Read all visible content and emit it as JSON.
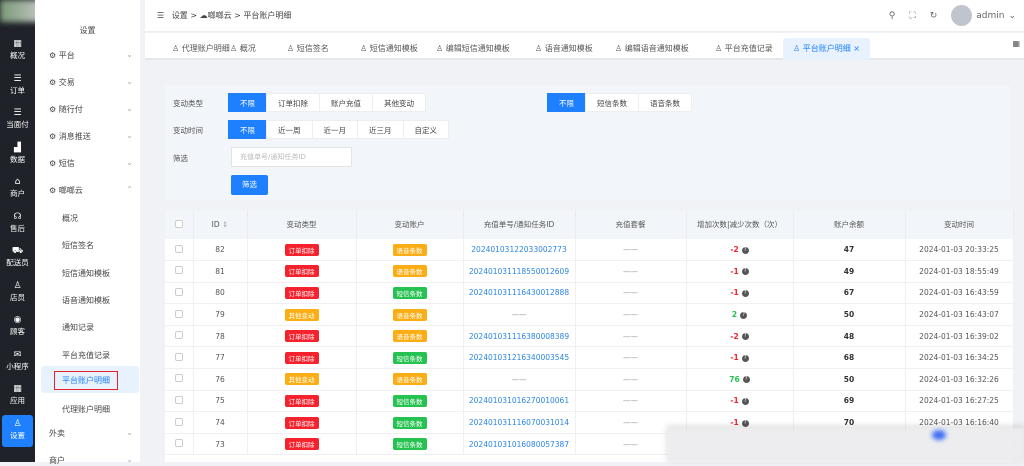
{
  "rail": [
    {
      "icon": "grid",
      "label": "概况"
    },
    {
      "icon": "list",
      "label": "订单"
    },
    {
      "icon": "list",
      "label": "当面付"
    },
    {
      "icon": "bar-chart",
      "label": "数据"
    },
    {
      "icon": "store",
      "label": "商户"
    },
    {
      "icon": "headset",
      "label": "售后"
    },
    {
      "icon": "scooter",
      "label": "配送员"
    },
    {
      "icon": "user",
      "label": "店员"
    },
    {
      "icon": "eye",
      "label": "顾客"
    },
    {
      "icon": "chat",
      "label": "小程序"
    },
    {
      "icon": "apps",
      "label": "应用"
    },
    {
      "icon": "user",
      "label": "设置"
    }
  ],
  "side": {
    "title": "设置",
    "menus": [
      {
        "label": "平台"
      },
      {
        "label": "交易"
      },
      {
        "label": "随行付"
      },
      {
        "label": "消息推送"
      },
      {
        "label": "短信"
      },
      {
        "label": "啷啷云"
      }
    ],
    "subs": [
      "概况",
      "短信签名",
      "短信通知模板",
      "语音通知模板",
      "通知记录",
      "平台充值记录",
      "平台账户明细",
      "代理账户明细"
    ],
    "after": [
      {
        "label": "外卖"
      },
      {
        "label": "商户"
      }
    ]
  },
  "breadcrumb": [
    "设置",
    "啷啷云",
    "平台账户明细"
  ],
  "user": "admin",
  "tabs": [
    "代理账户明细",
    "概况",
    "短信签名",
    "短信通知模板",
    "编辑短信通知模板",
    "语音通知模板",
    "编辑语音通知模板",
    "平台充值记录",
    "平台账户明细"
  ],
  "filters": {
    "type_label": "变动类型",
    "type_opts": [
      "不限",
      "订单扣除",
      "账户充值",
      "其他变动"
    ],
    "acct_opts": [
      "不限",
      "短信条数",
      "语音条数"
    ],
    "time_label": "变动时间",
    "time_opts": [
      "不限",
      "近一周",
      "近一月",
      "近三月",
      "自定义"
    ],
    "search_label": "筛选",
    "search_placeholder": "充值单号/通知任务ID",
    "search_btn": "筛选"
  },
  "table": {
    "headers": [
      "ID",
      "变动类型",
      "变动账户",
      "充值单号/通知任务ID",
      "充值套餐",
      "增加次数|减少次数（次）",
      "账户余额",
      "变动时间"
    ],
    "rows": [
      {
        "id": "82",
        "type": "订单扣除",
        "acct": "语音条数",
        "no": "20240103122033002773",
        "pkg": "——",
        "delta": "-2",
        "bal": "47",
        "time": "2024-01-03 20:33:25"
      },
      {
        "id": "81",
        "type": "订单扣除",
        "acct": "语音条数",
        "no": "20240103111855001260​9",
        "pkg": "——",
        "delta": "-1",
        "bal": "49",
        "time": "2024-01-03 18:55:49"
      },
      {
        "id": "80",
        "type": "订单扣除",
        "acct": "短信条数",
        "no": "20240103111643001288​8",
        "pkg": "——",
        "delta": "-1",
        "bal": "67",
        "time": "2024-01-03 16:43:59"
      },
      {
        "id": "79",
        "type": "其他变动",
        "acct": "语音条数",
        "no": "——",
        "pkg": "——",
        "delta": "2",
        "bal": "50",
        "time": "2024-01-03 16:43:07"
      },
      {
        "id": "78",
        "type": "订单扣除",
        "acct": "语音条数",
        "no": "20240103111638000838​9",
        "pkg": "——",
        "delta": "-2",
        "bal": "48",
        "time": "2024-01-03 16:39:02"
      },
      {
        "id": "77",
        "type": "订单扣除",
        "acct": "短信条数",
        "no": "20240103121634000354​5",
        "pkg": "——",
        "delta": "-1",
        "bal": "68",
        "time": "2024-01-03 16:34:25"
      },
      {
        "id": "76",
        "type": "其他变动",
        "acct": "语音条数",
        "no": "——",
        "pkg": "——",
        "delta": "76",
        "bal": "50",
        "time": "2024-01-03 16:32:26"
      },
      {
        "id": "75",
        "type": "订单扣除",
        "acct": "短信条数",
        "no": "20240103101627001006​1",
        "pkg": "——",
        "delta": "-1",
        "bal": "69",
        "time": "2024-01-03 16:27:25"
      },
      {
        "id": "74",
        "type": "订单扣除",
        "acct": "短信条数",
        "no": "20240103111607003101​4",
        "pkg": "——",
        "delta": "-1",
        "bal": "70",
        "time": "2024-01-03 16:16:40"
      },
      {
        "id": "73",
        "type": "订单扣除",
        "acct": "短信条数",
        "no": "20240103101608005738​7",
        "pkg": "——",
        "delta": "",
        "bal": "",
        "time": ""
      }
    ]
  },
  "colors": {
    "primary": "#1e80ff",
    "red": "#f5222d",
    "orange": "#faad14",
    "green": "#25c251"
  }
}
